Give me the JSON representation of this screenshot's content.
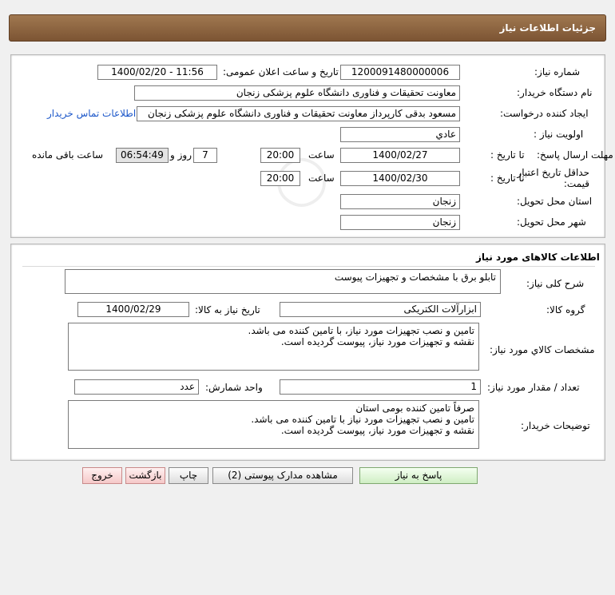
{
  "header": {
    "title": "جزئیات اطلاعات نیاز"
  },
  "details": {
    "need_number_label": "شماره نیاز:",
    "need_number": "1200091480000006",
    "announce_label": "تاریخ و ساعت اعلان عمومی:",
    "announce_value": "1400/02/20 - 11:56",
    "buyer_org_label": "نام دستگاه خریدار:",
    "buyer_org": "معاونت تحقیقات و فناوری دانشگاه علوم پزشکی زنجان",
    "requester_label": "ایجاد کننده درخواست:",
    "requester": "مسعود بدقی کارپرداز معاونت تحقیقات و فناوری دانشگاه علوم پزشکی زنجان",
    "contact_link": "اطلاعات تماس خریدار",
    "priority_label": "اولویت نیاز :",
    "priority": "عادي",
    "reply_deadline_label": "مهلت ارسال پاسخ:",
    "to_date_label": "تا تاریخ :",
    "reply_date": "1400/02/27",
    "time_label": "ساعت",
    "reply_time": "20:00",
    "days_count": "7",
    "days_label": "روز و",
    "remaining_time": "06:54:49",
    "remaining_label": "ساعت باقی مانده",
    "validity_label": "حداقل تاریخ اعتبار قیمت:",
    "validity_to_label": "تا تاریخ :",
    "validity_date": "1400/02/30",
    "validity_time_label": "ساعت",
    "validity_time": "20:00",
    "province_label": "استان محل تحویل:",
    "province": "زنجان",
    "city_label": "شهر محل تحویل:",
    "city": "زنجان"
  },
  "goods": {
    "section_title": "اطلاعات کالاهای مورد نیاز",
    "summary_label": "شرح کلی نیاز:",
    "summary": "تابلو برق با مشخصات و تجهیزات پیوست",
    "group_label": "گروه کالا:",
    "group": "ابزارآلات الکتریکی",
    "need_date_label": "تاریخ نیاز به کالا:",
    "need_date": "1400/02/29",
    "specs_label": "مشخصات کالاي مورد نیاز:",
    "specs_line1": "تامین و نصب تجهیزات مورد نیاز، با تامین کننده می باشد.",
    "specs_line2": "نقشه و تجهیزات مورد نیاز، پیوست گردیده است.",
    "qty_label": "تعداد / مقدار مورد نیاز:",
    "qty": "1",
    "unit_label": "واحد شمارش:",
    "unit": "عدد",
    "notes_label": "توضیحات خریدار:",
    "notes_line1": "صرفاً تامین کننده بومی استان",
    "notes_line2": "تامین و نصب تجهیزات مورد نیاز با تامین کننده می باشد.",
    "notes_line3": "نقشه و تجهیزات مورد نیاز، پیوست گردیده است."
  },
  "buttons": {
    "reply": "پاسخ به نیاز",
    "attachments": "مشاهده مدارک پیوستی (2)",
    "print": "چاپ",
    "back": "بازگشت",
    "exit": "خروج"
  }
}
